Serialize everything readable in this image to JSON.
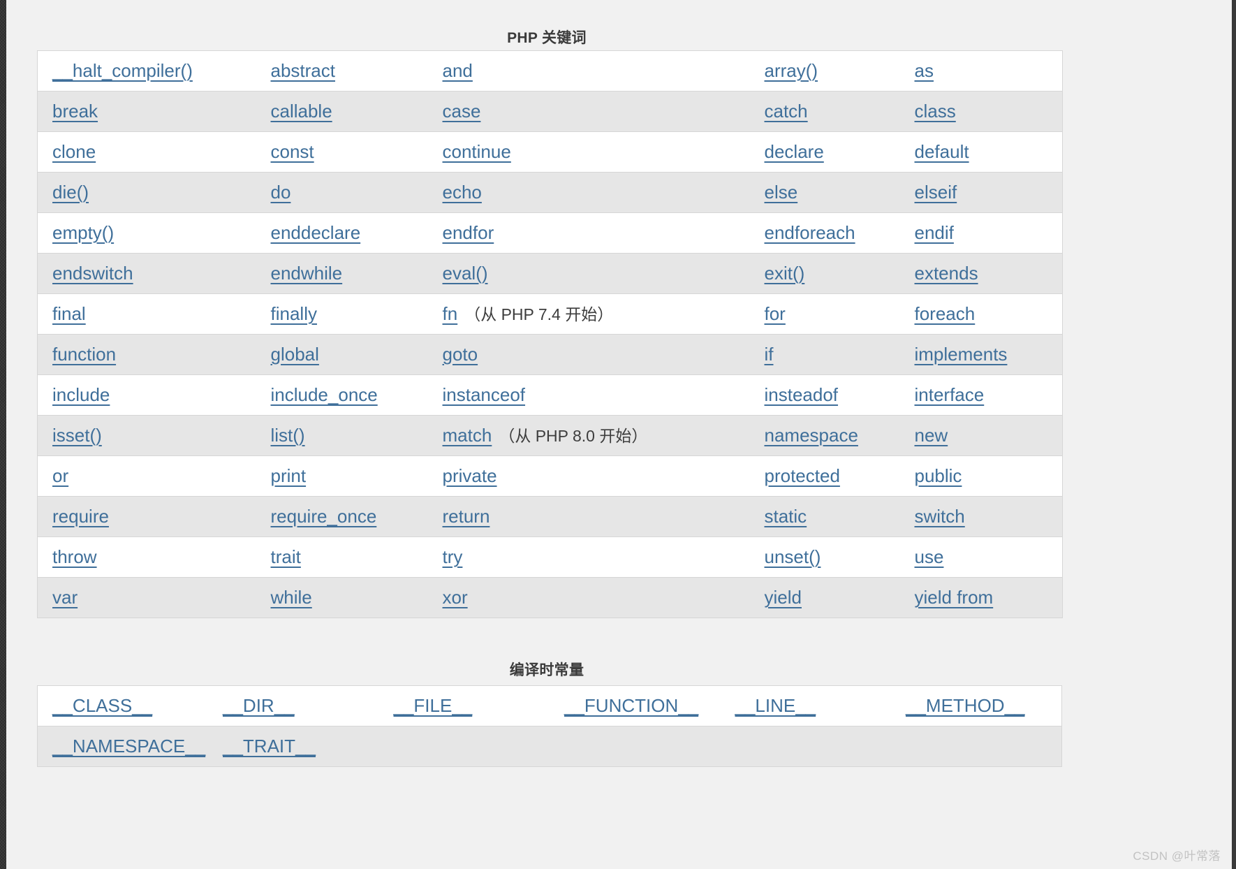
{
  "keywords_section": {
    "title": "PHP 关键词",
    "rows": [
      [
        {
          "text": "__halt_compiler()",
          "link": true
        },
        {
          "text": "abstract",
          "link": true
        },
        {
          "text": "and",
          "link": true
        },
        {
          "text": "array()",
          "link": true
        },
        {
          "text": "as",
          "link": true
        }
      ],
      [
        {
          "text": "break",
          "link": true
        },
        {
          "text": "callable",
          "link": true
        },
        {
          "text": "case",
          "link": true
        },
        {
          "text": "catch",
          "link": true
        },
        {
          "text": "class",
          "link": true
        }
      ],
      [
        {
          "text": "clone",
          "link": true
        },
        {
          "text": "const",
          "link": true
        },
        {
          "text": "continue",
          "link": true
        },
        {
          "text": "declare",
          "link": true
        },
        {
          "text": "default",
          "link": true
        }
      ],
      [
        {
          "text": "die()",
          "link": true
        },
        {
          "text": "do",
          "link": true
        },
        {
          "text": "echo",
          "link": true
        },
        {
          "text": "else",
          "link": true
        },
        {
          "text": "elseif",
          "link": true
        }
      ],
      [
        {
          "text": "empty()",
          "link": true
        },
        {
          "text": "enddeclare",
          "link": true
        },
        {
          "text": "endfor",
          "link": true
        },
        {
          "text": "endforeach",
          "link": true
        },
        {
          "text": "endif",
          "link": true
        }
      ],
      [
        {
          "text": "endswitch",
          "link": true
        },
        {
          "text": "endwhile",
          "link": true
        },
        {
          "text": "eval()",
          "link": true
        },
        {
          "text": "exit()",
          "link": true
        },
        {
          "text": "extends",
          "link": true
        }
      ],
      [
        {
          "text": "final",
          "link": true
        },
        {
          "text": "finally",
          "link": true
        },
        {
          "text": "fn",
          "link": true,
          "note": "（从 PHP 7.4 开始）"
        },
        {
          "text": "for",
          "link": true
        },
        {
          "text": "foreach",
          "link": true
        }
      ],
      [
        {
          "text": "function",
          "link": true
        },
        {
          "text": "global",
          "link": true
        },
        {
          "text": "goto",
          "link": true
        },
        {
          "text": "if",
          "link": true
        },
        {
          "text": "implements",
          "link": true
        }
      ],
      [
        {
          "text": "include",
          "link": true
        },
        {
          "text": "include_once",
          "link": true
        },
        {
          "text": "instanceof",
          "link": true
        },
        {
          "text": "insteadof",
          "link": true
        },
        {
          "text": "interface",
          "link": true
        }
      ],
      [
        {
          "text": "isset()",
          "link": true
        },
        {
          "text": "list()",
          "link": true
        },
        {
          "text": "match",
          "link": true,
          "note": "（从 PHP 8.0 开始）"
        },
        {
          "text": "namespace",
          "link": true
        },
        {
          "text": "new",
          "link": true
        }
      ],
      [
        {
          "text": "or",
          "link": true
        },
        {
          "text": "print",
          "link": true
        },
        {
          "text": "private",
          "link": true
        },
        {
          "text": "protected",
          "link": true
        },
        {
          "text": "public",
          "link": true
        }
      ],
      [
        {
          "text": "require",
          "link": true
        },
        {
          "text": "require_once",
          "link": true
        },
        {
          "text": "return",
          "link": true
        },
        {
          "text": "static",
          "link": true
        },
        {
          "text": "switch",
          "link": true
        }
      ],
      [
        {
          "text": "throw",
          "link": true
        },
        {
          "text": "trait",
          "link": true
        },
        {
          "text": "try",
          "link": true
        },
        {
          "text": "unset()",
          "link": true
        },
        {
          "text": "use",
          "link": true
        }
      ],
      [
        {
          "text": "var",
          "link": true
        },
        {
          "text": "while",
          "link": true
        },
        {
          "text": "xor",
          "link": true
        },
        {
          "text": "yield",
          "link": true
        },
        {
          "text": "yield from",
          "link": true
        }
      ]
    ]
  },
  "constants_section": {
    "title": "编译时常量",
    "rows": [
      [
        {
          "text": "__CLASS__",
          "link": true
        },
        {
          "text": "__DIR__",
          "link": true
        },
        {
          "text": "__FILE__",
          "link": true
        },
        {
          "text": "__FUNCTION__",
          "link": true
        },
        {
          "text": "__LINE__",
          "link": true
        },
        {
          "text": "__METHOD__",
          "link": true
        }
      ],
      [
        {
          "text": "__NAMESPACE__",
          "link": true
        },
        {
          "text": "__TRAIT__",
          "link": true
        },
        {
          "text": "",
          "link": false
        },
        {
          "text": "",
          "link": false
        },
        {
          "text": "",
          "link": false
        },
        {
          "text": "",
          "link": false
        }
      ]
    ]
  },
  "watermark": "CSDN @叶常落",
  "colors": {
    "link": "#3f6f9a",
    "page_background": "#f1f1f1",
    "table_background": "#ffffff",
    "row_alt_background": "#e6e6e6",
    "border": "#d6d6d6",
    "title_text": "#3b3b3b",
    "watermark_text": "#c2c2c2"
  }
}
